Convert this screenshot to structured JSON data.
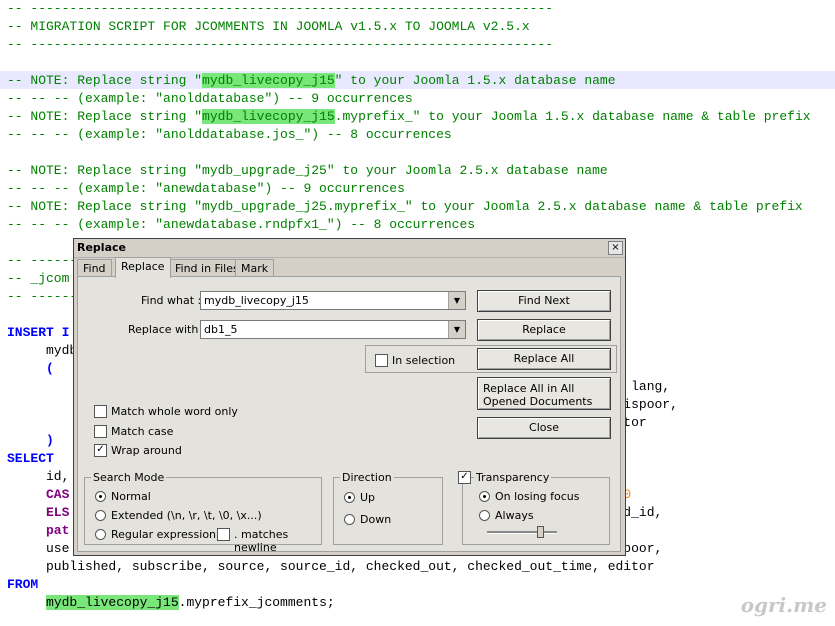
{
  "editor": {
    "lines": [
      {
        "parts": [
          {
            "t": "-- -------------------------------------------------------------------",
            "c": "cmt"
          }
        ]
      },
      {
        "parts": [
          {
            "t": "-- MIGRATION SCRIPT FOR JCOMMENTS IN JOOMLA v1.5.x TO JOOMLA v2.5.x",
            "c": "cmt"
          }
        ]
      },
      {
        "parts": [
          {
            "t": "-- -------------------------------------------------------------------",
            "c": "cmt"
          }
        ]
      },
      {
        "parts": [
          {
            "t": "",
            "c": "cmt"
          }
        ]
      },
      {
        "parts": [
          {
            "t": "-- NOTE: Replace string \"",
            "c": "cmt"
          },
          {
            "t": "mydb_livecopy_j15",
            "c": "cmt hl"
          },
          {
            "t": "\" to your Joomla 1.5.x database name",
            "c": "cmt"
          }
        ]
      },
      {
        "parts": [
          {
            "t": "-- -- -- (example: \"anolddatabase\") -- 9 occurrences",
            "c": "cmt"
          }
        ]
      },
      {
        "parts": [
          {
            "t": "-- NOTE: Replace string \"",
            "c": "cmt"
          },
          {
            "t": "mydb_livecopy_j15",
            "c": "cmt hl"
          },
          {
            "t": ".myprefix_\" to your Joomla 1.5.x database name & table prefix",
            "c": "cmt"
          }
        ]
      },
      {
        "parts": [
          {
            "t": "-- -- -- (example: \"anolddatabase.jos_\") -- 8 occurrences",
            "c": "cmt"
          }
        ]
      },
      {
        "parts": [
          {
            "t": "",
            "c": "cmt"
          }
        ]
      },
      {
        "parts": [
          {
            "t": "-- NOTE: Replace string \"mydb_upgrade_j25\" to your Joomla 2.5.x database name",
            "c": "cmt"
          }
        ]
      },
      {
        "parts": [
          {
            "t": "-- -- -- (example: \"anewdatabase\") -- 9 occurrences",
            "c": "cmt"
          }
        ]
      },
      {
        "parts": [
          {
            "t": "-- NOTE: Replace string \"mydb_upgrade_j25.myprefix_\" to your Joomla 2.5.x database name & table prefix",
            "c": "cmt"
          }
        ]
      },
      {
        "parts": [
          {
            "t": "-- -- -- (example: \"anewdatabase.rndpfx1_\") -- 8 occurrences",
            "c": "cmt"
          }
        ]
      },
      {
        "parts": [
          {
            "t": "",
            "c": "cmt"
          }
        ]
      },
      {
        "parts": [
          {
            "t": "-- -------------------------------------------------------------------",
            "c": "cmt"
          }
        ]
      },
      {
        "parts": [
          {
            "t": "-- _jcom",
            "c": "cmt"
          }
        ]
      },
      {
        "parts": [
          {
            "t": "-- -------------------------------------------------------------------",
            "c": "cmt"
          }
        ]
      },
      {
        "parts": [
          {
            "t": "",
            "c": ""
          }
        ]
      },
      {
        "parts": [
          {
            "t": "INSERT I",
            "c": "kw"
          }
        ]
      },
      {
        "parts": [
          {
            "t": "     mydb",
            "c": ""
          }
        ]
      },
      {
        "parts": [
          {
            "t": "     (",
            "c": "kw"
          }
        ]
      },
      {
        "parts": [
          {
            "t": "                                                                       _params, lang,",
            "c": ""
          }
        ]
      },
      {
        "parts": [
          {
            "t": "                                                                       isgood, ispoor,",
            "c": ""
          }
        ]
      },
      {
        "parts": [
          {
            "t": "                                                                       ime, editor",
            "c": ""
          }
        ]
      },
      {
        "parts": [
          {
            "t": "     )",
            "c": "kw"
          }
        ]
      },
      {
        "parts": [
          {
            "t": "SELECT",
            "c": "kw"
          }
        ]
      },
      {
        "parts": [
          {
            "t": "     id,",
            "c": ""
          }
        ]
      },
      {
        "parts": [
          {
            "t": "     CAS",
            "c": "kwp"
          },
          {
            "t": "                                                                  ",
            "c": ""
          },
          {
            "t": "THEN",
            "c": "kwp"
          },
          {
            "t": " ",
            "c": ""
          },
          {
            "t": "0",
            "c": "num"
          }
        ]
      },
      {
        "parts": [
          {
            "t": "     ELS",
            "c": "kwp"
          },
          {
            "t": "                                                                  thread_id,",
            "c": ""
          }
        ]
      },
      {
        "parts": [
          {
            "t": "     pat",
            "c": "kwp"
          }
        ]
      },
      {
        "parts": [
          {
            "t": "     use",
            "c": ""
          },
          {
            "t": "                                                                  d, ispoor,",
            "c": ""
          }
        ]
      },
      {
        "parts": [
          {
            "t": "     published, subscribe, source, source_id, checked_out, checked_out_time, editor",
            "c": ""
          }
        ]
      },
      {
        "parts": [
          {
            "t": "FROM",
            "c": "kw"
          }
        ]
      },
      {
        "parts": [
          {
            "t": "     ",
            "c": ""
          },
          {
            "t": "mydb_livecopy_j15",
            "c": "hl"
          },
          {
            "t": ".myprefix_jcomments;",
            "c": ""
          }
        ]
      }
    ],
    "watermark": "ogri.me"
  },
  "dialog": {
    "title": "Replace",
    "close_label": "×",
    "tabs": [
      "Find",
      "Replace",
      "Find in Files",
      "Mark"
    ],
    "active_tab": "Replace",
    "find_what_label": "Find what :",
    "find_what_value": "mydb_livecopy_j15",
    "replace_with_label": "Replace with :",
    "replace_with_value": "db1_5",
    "buttons": {
      "find_next": "Find Next",
      "replace": "Replace",
      "replace_all": "Replace All",
      "replace_all_open": "Replace All in All Opened Documents",
      "close": "Close"
    },
    "in_selection": "In selection",
    "options": {
      "whole_word": "Match whole word only",
      "match_case": "Match case",
      "wrap_around": "Wrap around"
    },
    "search_mode": {
      "title": "Search Mode",
      "normal": "Normal",
      "extended": "Extended (\\n, \\r, \\t, \\0, \\x...)",
      "regex": "Regular expression",
      "matches_newline": ". matches newline"
    },
    "direction": {
      "title": "Direction",
      "up": "Up",
      "down": "Down"
    },
    "transparency": {
      "title": "Transparency",
      "on_losing_focus": "On losing focus",
      "always": "Always",
      "level": 0.75
    }
  }
}
